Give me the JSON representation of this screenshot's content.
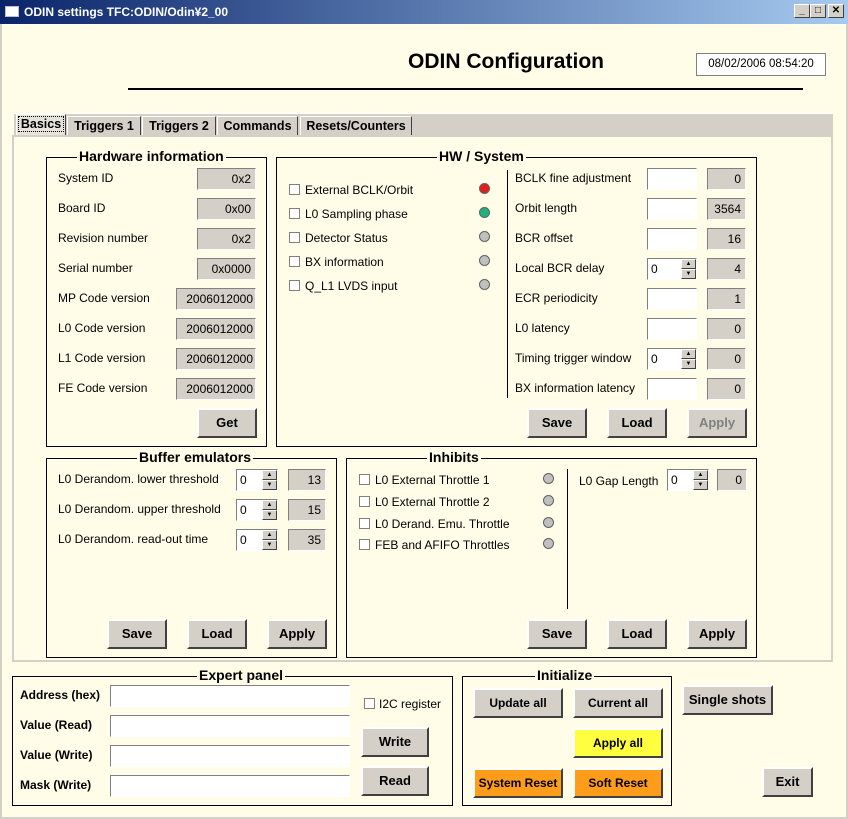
{
  "window": {
    "title": "ODIN settings TFC:ODIN/Odin¥2_00",
    "minimize": "_",
    "maximize": "□",
    "close": "✕"
  },
  "header": {
    "title": "ODIN Configuration",
    "datetime": "08/02/2006  08:54:20"
  },
  "tabs": [
    "Basics",
    "Triggers 1",
    "Triggers 2",
    "Commands",
    "Resets/Counters"
  ],
  "hardware": {
    "title": "Hardware information",
    "rows": [
      {
        "label": "System ID",
        "value": "0x2"
      },
      {
        "label": "Board ID",
        "value": "0x00"
      },
      {
        "label": "Revision number",
        "value": "0x2"
      },
      {
        "label": "Serial number",
        "value": "0x0000"
      },
      {
        "label": "MP Code version",
        "value": "2006012000"
      },
      {
        "label": "L0 Code version",
        "value": "2006012000"
      },
      {
        "label": "L1 Code version",
        "value": "2006012000"
      },
      {
        "label": "FE Code version",
        "value": "2006012000"
      }
    ],
    "get_label": "Get"
  },
  "hw_system": {
    "title": "HW / System",
    "checks": [
      {
        "label": "External BCLK/Orbit",
        "led": "#e02020"
      },
      {
        "label": "L0 Sampling phase",
        "led": "#20b080"
      },
      {
        "label": "Detector Status",
        "led": "#c0c0c0"
      },
      {
        "label": "BX information",
        "led": "#c0c0c0"
      },
      {
        "label": "Q_L1 LVDS input",
        "led": "#c0c0c0"
      }
    ],
    "params": [
      {
        "label": "BCLK fine adjustment",
        "input": "",
        "value": "0"
      },
      {
        "label": "Orbit length",
        "input": "",
        "value": "3564"
      },
      {
        "label": "BCR offset",
        "input": "",
        "value": "16"
      },
      {
        "label": "Local BCR delay",
        "input": "0",
        "value": "4"
      },
      {
        "label": "ECR periodicity",
        "input": "",
        "value": "1"
      },
      {
        "label": "L0 latency",
        "input": "",
        "value": "0"
      },
      {
        "label": "Timing trigger window",
        "input": "0",
        "value": "0"
      },
      {
        "label": "BX information latency",
        "input": "",
        "value": "0"
      }
    ],
    "save": "Save",
    "load": "Load",
    "apply": "Apply"
  },
  "buffer": {
    "title": "Buffer emulators",
    "rows": [
      {
        "label": "L0 Derandom. lower threshold",
        "input": "0",
        "value": "13"
      },
      {
        "label": "L0 Derandom. upper threshold",
        "input": "0",
        "value": "15"
      },
      {
        "label": "L0 Derandom. read-out time",
        "input": "0",
        "value": "35"
      }
    ],
    "save": "Save",
    "load": "Load",
    "apply": "Apply"
  },
  "inhibits": {
    "title": "Inhibits",
    "checks": [
      {
        "label": "L0 External Throttle 1"
      },
      {
        "label": "L0 External Throttle 2"
      },
      {
        "label": "L0 Derand. Emu. Throttle"
      },
      {
        "label": "FEB and AFIFO Throttles"
      }
    ],
    "gap_label": "L0 Gap Length",
    "gap_input": "0",
    "gap_value": "0",
    "save": "Save",
    "load": "Load",
    "apply": "Apply"
  },
  "expert": {
    "title": "Expert panel",
    "address_label": "Address (hex)",
    "value_read_label": "Value (Read)",
    "value_write_label": "Value (Write)",
    "mask_label": "Mask (Write)",
    "i2c_label": "I2C register",
    "write": "Write",
    "read": "Read"
  },
  "initialize": {
    "title": "Initialize",
    "update_all": "Update all",
    "current_all": "Current all",
    "apply_all": "Apply all",
    "system_reset": "System Reset",
    "soft_reset": "Soft Reset"
  },
  "single_shots": "Single shots",
  "exit": "Exit"
}
